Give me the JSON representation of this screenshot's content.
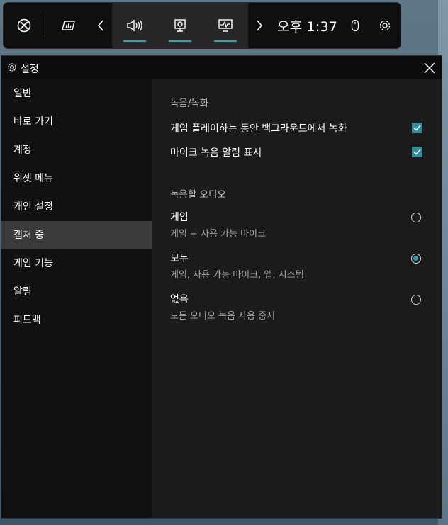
{
  "topbar": {
    "clock": "오후 1:37",
    "icons": [
      "xbox-logo",
      "widget-performance",
      "chevron-left",
      "audio",
      "capture",
      "performance",
      "chevron-right",
      "mouse",
      "settings"
    ]
  },
  "window": {
    "title": "설정"
  },
  "nav": {
    "items": [
      {
        "label": "일반"
      },
      {
        "label": "바로 가기"
      },
      {
        "label": "계정"
      },
      {
        "label": "위젯 메뉴"
      },
      {
        "label": "개인 설정"
      },
      {
        "label": "캡처 중"
      },
      {
        "label": "게임 기능"
      },
      {
        "label": "알림"
      },
      {
        "label": "피드백"
      }
    ],
    "selected_index": 5
  },
  "main": {
    "section1_title": "녹음/녹화",
    "options": [
      {
        "label": "게임 플레이하는 동안 백그라운드에서 녹화",
        "checked": true
      },
      {
        "label": "마이크 녹음 알림 표시",
        "checked": true
      }
    ],
    "section2_title": "녹음할 오디오",
    "audio_choices": [
      {
        "label": "게임",
        "sub": "게임 + 사용 가능 마이크",
        "selected": false
      },
      {
        "label": "모두",
        "sub": "게임, 사용 가능 마이크, 앱, 시스템",
        "selected": true
      },
      {
        "label": "없음",
        "sub": "모든 오디오 녹음 사용 중지",
        "selected": false
      }
    ]
  },
  "colors": {
    "accent": "#2b8fa3",
    "window_bg": "#1b1b1b",
    "nav_bg": "#111111",
    "selected_bg": "#3a3a3a"
  }
}
